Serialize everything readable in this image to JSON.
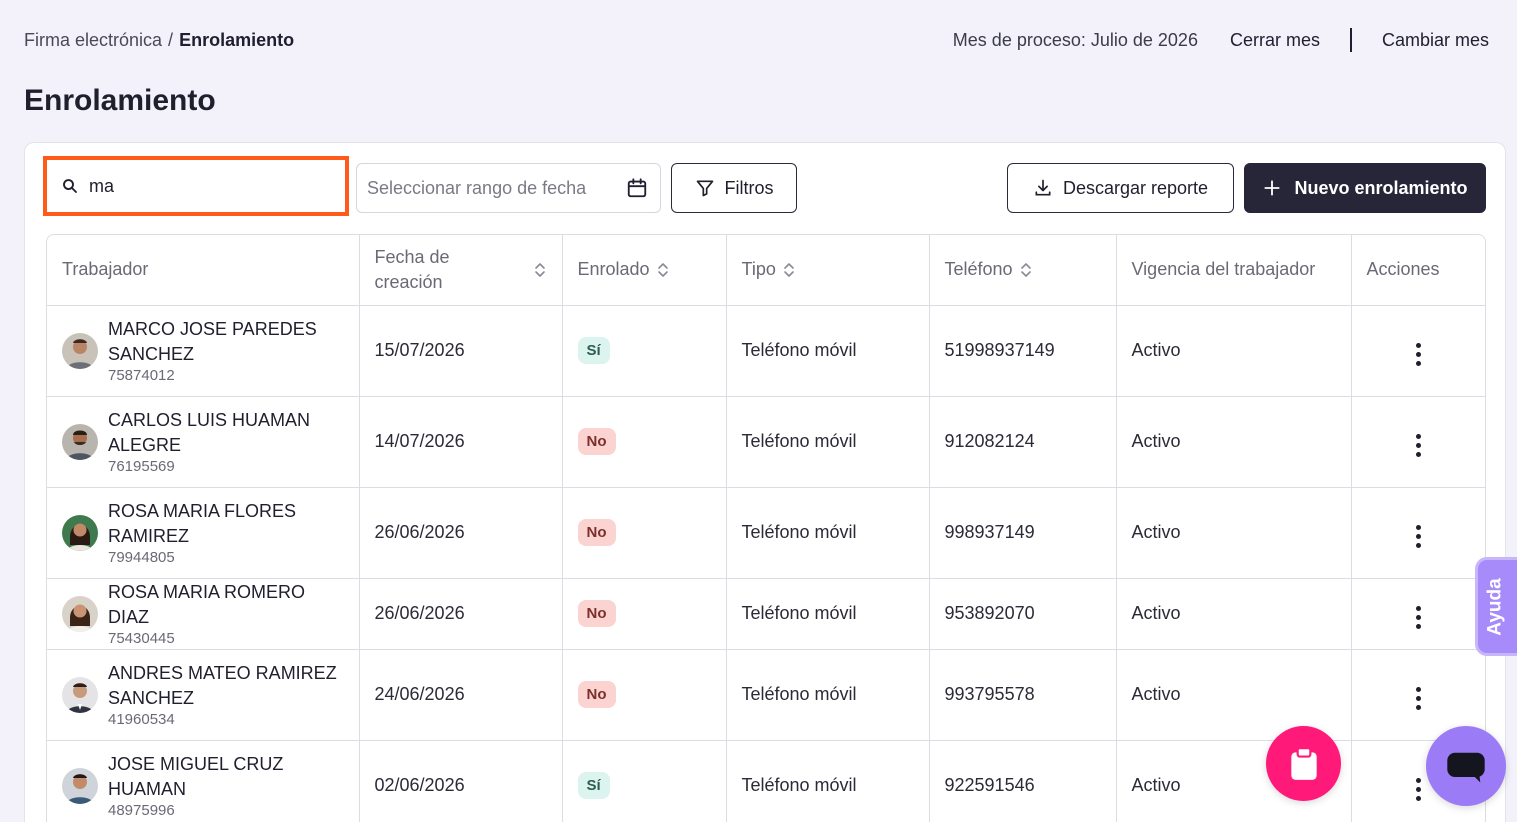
{
  "breadcrumb": {
    "parent": "Firma electrónica",
    "separator": "/",
    "current": "Enrolamiento"
  },
  "period": {
    "label": "Mes de proceso: Julio de 2026",
    "close": "Cerrar mes",
    "change": "Cambiar mes"
  },
  "page_title": "Enrolamiento",
  "toolbar": {
    "search_value": "ma",
    "date_placeholder": "Seleccionar rango de fecha",
    "filters": "Filtros",
    "download": "Descargar reporte",
    "new": "Nuevo enrolamiento"
  },
  "table": {
    "headers": {
      "worker": "Trabajador",
      "created": "Fecha de creación",
      "enrolled": "Enrolado",
      "type": "Tipo",
      "phone": "Teléfono",
      "validity": "Vigencia del trabajador",
      "actions": "Acciones"
    },
    "rows": [
      {
        "name": "MARCO JOSE PAREDES SANCHEZ",
        "doc": "75874012",
        "created": "15/07/2026",
        "enrolled": "Sí",
        "type": "Teléfono móvil",
        "phone": "51998937149",
        "validity": "Activo"
      },
      {
        "name": "CARLOS LUIS HUAMAN ALEGRE",
        "doc": "76195569",
        "created": "14/07/2026",
        "enrolled": "No",
        "type": "Teléfono móvil",
        "phone": "912082124",
        "validity": "Activo"
      },
      {
        "name": "ROSA MARIA FLORES RAMIREZ",
        "doc": "79944805",
        "created": "26/06/2026",
        "enrolled": "No",
        "type": "Teléfono móvil",
        "phone": "998937149",
        "validity": "Activo"
      },
      {
        "name": "ROSA MARIA ROMERO DIAZ",
        "doc": "75430445",
        "created": "26/06/2026",
        "enrolled": "No",
        "type": "Teléfono móvil",
        "phone": "953892070",
        "validity": "Activo"
      },
      {
        "name": "ANDRES MATEO RAMIREZ SANCHEZ",
        "doc": "41960534",
        "created": "24/06/2026",
        "enrolled": "No",
        "type": "Teléfono móvil",
        "phone": "993795578",
        "validity": "Activo"
      },
      {
        "name": "JOSE MIGUEL CRUZ HUAMAN",
        "doc": "48975996",
        "created": "02/06/2026",
        "enrolled": "Sí",
        "type": "Teléfono móvil",
        "phone": "922591546",
        "validity": "Activo"
      }
    ]
  },
  "help_tab": "Ayuda",
  "colors": {
    "accent": "#262638",
    "highlight": "#ff5a1a",
    "pink_fab": "#ff1a7a",
    "chat_fab": "#9b7cf6"
  }
}
